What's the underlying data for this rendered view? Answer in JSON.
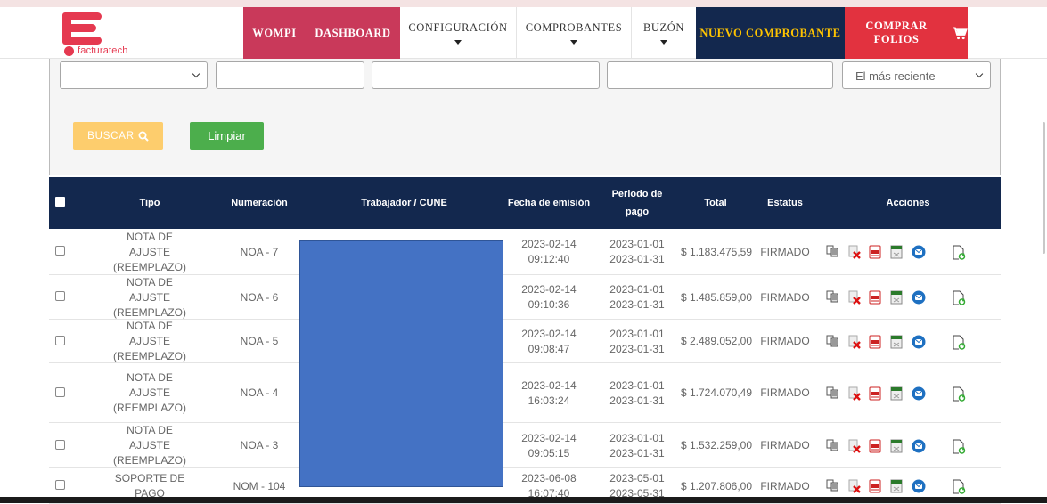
{
  "brand": {
    "name": "facturatech",
    "color": "#e53950"
  },
  "nav": [
    {
      "label": "WOMPI",
      "caret": false
    },
    {
      "label": "DASHBOARD",
      "caret": false
    },
    {
      "label": "CONFIGURACIÓN",
      "caret": true
    },
    {
      "label": "COMPROBANTES",
      "caret": true
    },
    {
      "label": "BUZÓN",
      "caret": true
    },
    {
      "label": "NUEVO COMPROBANTE",
      "caret": false
    },
    {
      "label": "COMPRAR FOLIOS",
      "caret": false,
      "icon": "cart-icon"
    }
  ],
  "filters": {
    "select1": "",
    "input1": "",
    "input2": "",
    "input3": "",
    "sort": "El más reciente",
    "buscar_label": "BUSCAR",
    "limpiar_label": "Limpiar"
  },
  "table": {
    "headers": [
      "Tipo",
      "Numeración",
      "Trabajador / CUNE",
      "Fecha de emisión",
      "Periodo de pago",
      "Total",
      "Estatus",
      "Acciones"
    ],
    "rows": [
      {
        "tipo": "NOTA DE AJUSTE (REEMPLAZO)",
        "num": "NOA - 7",
        "fecha": "2023-02-14",
        "hora": "09:12:40",
        "p1": "2023-01-01",
        "p2": "2023-01-31",
        "total": "$ 1.183.475,59",
        "estatus": "FIRMADO"
      },
      {
        "tipo": "NOTA DE AJUSTE (REEMPLAZO)",
        "num": "NOA - 6",
        "fecha": "2023-02-14",
        "hora": "09:10:36",
        "p1": "2023-01-01",
        "p2": "2023-01-31",
        "total": "$ 1.485.859,00",
        "estatus": "FIRMADO"
      },
      {
        "tipo": "NOTA DE AJUSTE (REEMPLAZO)",
        "num": "NOA - 5",
        "fecha": "2023-02-14",
        "hora": "09:08:47",
        "p1": "2023-01-01",
        "p2": "2023-01-31",
        "total": "$ 2.489.052,00",
        "estatus": "FIRMADO"
      },
      {
        "tipo": "NOTA DE AJUSTE (REEMPLAZO)",
        "num": "NOA - 4",
        "fecha": "2023-02-14",
        "hora": "16:03:24",
        "p1": "2023-01-01",
        "p2": "2023-01-31",
        "total": "$ 1.724.070,49",
        "estatus": "FIRMADO"
      },
      {
        "tipo": "NOTA DE AJUSTE (REEMPLAZO)",
        "num": "NOA - 3",
        "fecha": "2023-02-14",
        "hora": "09:05:15",
        "p1": "2023-01-01",
        "p2": "2023-01-31",
        "total": "$ 1.532.259,00",
        "estatus": "FIRMADO"
      },
      {
        "tipo": "SOPORTE DE PAGO",
        "num": "NOM - 104",
        "fecha": "2023-06-08",
        "hora": "16:07:40",
        "p1": "2023-05-01",
        "p2": "2023-05-31",
        "total": "$ 1.207.806,00",
        "estatus": "FIRMADO"
      }
    ],
    "action_icons": [
      "copy-icon",
      "cancel-icon",
      "pdf-icon",
      "xml-icon",
      "email-icon",
      "regenerate-icon"
    ]
  },
  "colors": {
    "navy": "#13284e",
    "pink": "#c9395a",
    "red": "#e2323f",
    "yellow_text": "#ffc400",
    "redaction": "#4472c4"
  }
}
